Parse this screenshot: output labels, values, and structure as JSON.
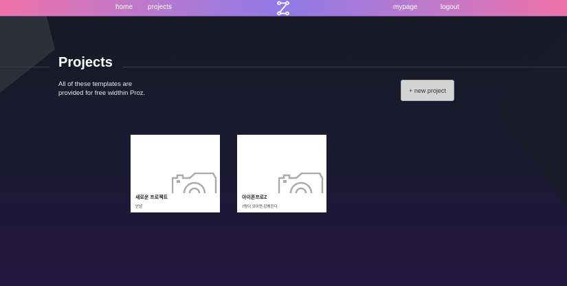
{
  "nav": {
    "home": "home",
    "projects": "projects",
    "mypage": "mypage",
    "logout": "logout",
    "logo_icon": "z-node-logo"
  },
  "header": {
    "title": "Projects",
    "description": "All of these templates are provided for free widthin Proz.",
    "new_project_label": "+ new project"
  },
  "projects": [
    {
      "name": "새로운 프로젝트",
      "description": "안녕",
      "thumbnail_icon": "camera-icon"
    },
    {
      "name": "아이폰프로Z",
      "description": "7명이 모이면 강해진다",
      "thumbnail_icon": "camera-icon"
    }
  ],
  "colors": {
    "nav_gradient": [
      "#ef72a8",
      "#8f7ae5"
    ],
    "background": "#161922"
  }
}
